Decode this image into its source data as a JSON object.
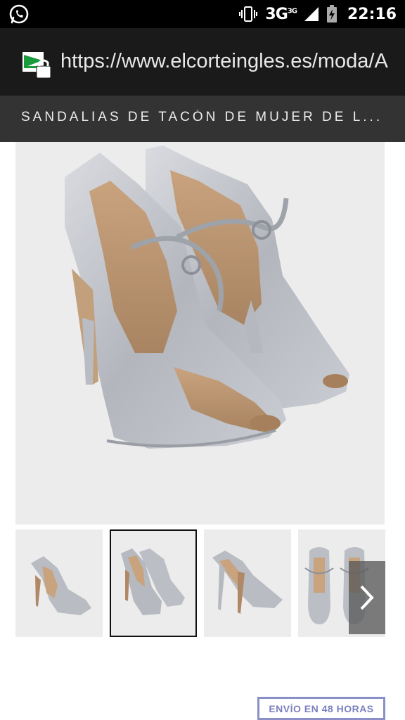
{
  "status_bar": {
    "network": "3G",
    "network_sup": "3G",
    "time": "22:16",
    "icons": [
      "whatsapp-icon",
      "vibrate-icon",
      "signal-icon",
      "battery-charging-icon"
    ]
  },
  "browser": {
    "url": "https://www.elcorteingles.es/moda/A",
    "site_icon": "secure-site-lock-icon"
  },
  "page": {
    "title": "SANDALIAS DE TACÓN DE MUJER DE L..."
  },
  "gallery": {
    "thumbnail_count": 4,
    "selected_index": 1,
    "next_icon": "chevron-right-icon"
  },
  "shipping_badge": {
    "label": "ENVÍO EN 48 HORAS"
  },
  "colors": {
    "status_bar_bg": "#000000",
    "url_bar_bg": "#1a1a1a",
    "title_bar_bg": "#333333",
    "image_bg": "#ececec",
    "badge_color": "#8a8fc8"
  }
}
